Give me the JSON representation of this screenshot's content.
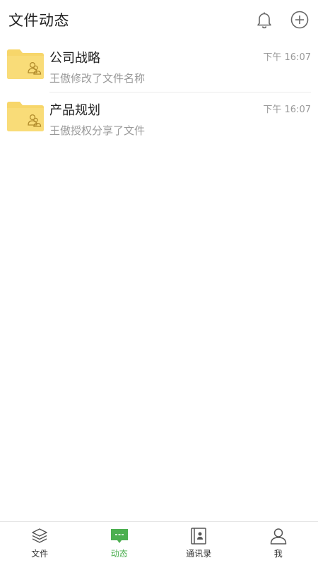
{
  "header": {
    "title": "文件动态",
    "bell_icon": "bell-icon",
    "add_icon": "plus-circle-icon"
  },
  "colors": {
    "accent": "#4caf50",
    "folder": "#f7d66a",
    "muted_text": "#9a9a9a"
  },
  "feed": [
    {
      "title": "公司战略",
      "subtitle": "王傲修改了文件名称",
      "time": "下午 16:07",
      "icon": "shared-folder-icon"
    },
    {
      "title": "产品规划",
      "subtitle": "王傲授权分享了文件",
      "time": "下午 16:07",
      "icon": "shared-folder-icon"
    }
  ],
  "bottom_nav": {
    "active": "动态",
    "items": [
      {
        "label": "文件",
        "icon": "layers-icon"
      },
      {
        "label": "动态",
        "icon": "message-icon"
      },
      {
        "label": "通讯录",
        "icon": "contacts-book-icon"
      },
      {
        "label": "我",
        "icon": "person-icon"
      }
    ]
  }
}
